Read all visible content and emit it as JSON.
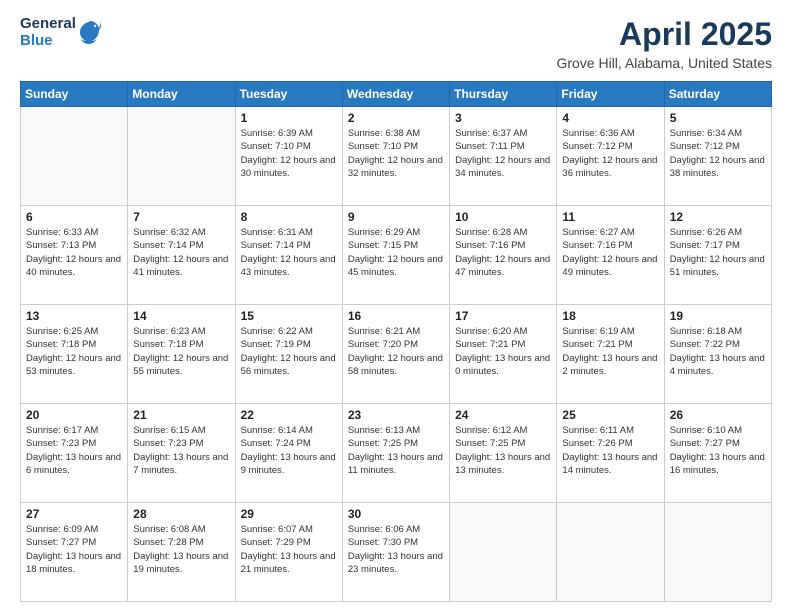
{
  "header": {
    "logo_general": "General",
    "logo_blue": "Blue",
    "title": "April 2025",
    "location": "Grove Hill, Alabama, United States"
  },
  "days_of_week": [
    "Sunday",
    "Monday",
    "Tuesday",
    "Wednesday",
    "Thursday",
    "Friday",
    "Saturday"
  ],
  "weeks": [
    [
      {
        "day": "",
        "info": ""
      },
      {
        "day": "",
        "info": ""
      },
      {
        "day": "1",
        "info": "Sunrise: 6:39 AM\nSunset: 7:10 PM\nDaylight: 12 hours and 30 minutes."
      },
      {
        "day": "2",
        "info": "Sunrise: 6:38 AM\nSunset: 7:10 PM\nDaylight: 12 hours and 32 minutes."
      },
      {
        "day": "3",
        "info": "Sunrise: 6:37 AM\nSunset: 7:11 PM\nDaylight: 12 hours and 34 minutes."
      },
      {
        "day": "4",
        "info": "Sunrise: 6:36 AM\nSunset: 7:12 PM\nDaylight: 12 hours and 36 minutes."
      },
      {
        "day": "5",
        "info": "Sunrise: 6:34 AM\nSunset: 7:12 PM\nDaylight: 12 hours and 38 minutes."
      }
    ],
    [
      {
        "day": "6",
        "info": "Sunrise: 6:33 AM\nSunset: 7:13 PM\nDaylight: 12 hours and 40 minutes."
      },
      {
        "day": "7",
        "info": "Sunrise: 6:32 AM\nSunset: 7:14 PM\nDaylight: 12 hours and 41 minutes."
      },
      {
        "day": "8",
        "info": "Sunrise: 6:31 AM\nSunset: 7:14 PM\nDaylight: 12 hours and 43 minutes."
      },
      {
        "day": "9",
        "info": "Sunrise: 6:29 AM\nSunset: 7:15 PM\nDaylight: 12 hours and 45 minutes."
      },
      {
        "day": "10",
        "info": "Sunrise: 6:28 AM\nSunset: 7:16 PM\nDaylight: 12 hours and 47 minutes."
      },
      {
        "day": "11",
        "info": "Sunrise: 6:27 AM\nSunset: 7:16 PM\nDaylight: 12 hours and 49 minutes."
      },
      {
        "day": "12",
        "info": "Sunrise: 6:26 AM\nSunset: 7:17 PM\nDaylight: 12 hours and 51 minutes."
      }
    ],
    [
      {
        "day": "13",
        "info": "Sunrise: 6:25 AM\nSunset: 7:18 PM\nDaylight: 12 hours and 53 minutes."
      },
      {
        "day": "14",
        "info": "Sunrise: 6:23 AM\nSunset: 7:18 PM\nDaylight: 12 hours and 55 minutes."
      },
      {
        "day": "15",
        "info": "Sunrise: 6:22 AM\nSunset: 7:19 PM\nDaylight: 12 hours and 56 minutes."
      },
      {
        "day": "16",
        "info": "Sunrise: 6:21 AM\nSunset: 7:20 PM\nDaylight: 12 hours and 58 minutes."
      },
      {
        "day": "17",
        "info": "Sunrise: 6:20 AM\nSunset: 7:21 PM\nDaylight: 13 hours and 0 minutes."
      },
      {
        "day": "18",
        "info": "Sunrise: 6:19 AM\nSunset: 7:21 PM\nDaylight: 13 hours and 2 minutes."
      },
      {
        "day": "19",
        "info": "Sunrise: 6:18 AM\nSunset: 7:22 PM\nDaylight: 13 hours and 4 minutes."
      }
    ],
    [
      {
        "day": "20",
        "info": "Sunrise: 6:17 AM\nSunset: 7:23 PM\nDaylight: 13 hours and 6 minutes."
      },
      {
        "day": "21",
        "info": "Sunrise: 6:15 AM\nSunset: 7:23 PM\nDaylight: 13 hours and 7 minutes."
      },
      {
        "day": "22",
        "info": "Sunrise: 6:14 AM\nSunset: 7:24 PM\nDaylight: 13 hours and 9 minutes."
      },
      {
        "day": "23",
        "info": "Sunrise: 6:13 AM\nSunset: 7:25 PM\nDaylight: 13 hours and 11 minutes."
      },
      {
        "day": "24",
        "info": "Sunrise: 6:12 AM\nSunset: 7:25 PM\nDaylight: 13 hours and 13 minutes."
      },
      {
        "day": "25",
        "info": "Sunrise: 6:11 AM\nSunset: 7:26 PM\nDaylight: 13 hours and 14 minutes."
      },
      {
        "day": "26",
        "info": "Sunrise: 6:10 AM\nSunset: 7:27 PM\nDaylight: 13 hours and 16 minutes."
      }
    ],
    [
      {
        "day": "27",
        "info": "Sunrise: 6:09 AM\nSunset: 7:27 PM\nDaylight: 13 hours and 18 minutes."
      },
      {
        "day": "28",
        "info": "Sunrise: 6:08 AM\nSunset: 7:28 PM\nDaylight: 13 hours and 19 minutes."
      },
      {
        "day": "29",
        "info": "Sunrise: 6:07 AM\nSunset: 7:29 PM\nDaylight: 13 hours and 21 minutes."
      },
      {
        "day": "30",
        "info": "Sunrise: 6:06 AM\nSunset: 7:30 PM\nDaylight: 13 hours and 23 minutes."
      },
      {
        "day": "",
        "info": ""
      },
      {
        "day": "",
        "info": ""
      },
      {
        "day": "",
        "info": ""
      }
    ]
  ]
}
